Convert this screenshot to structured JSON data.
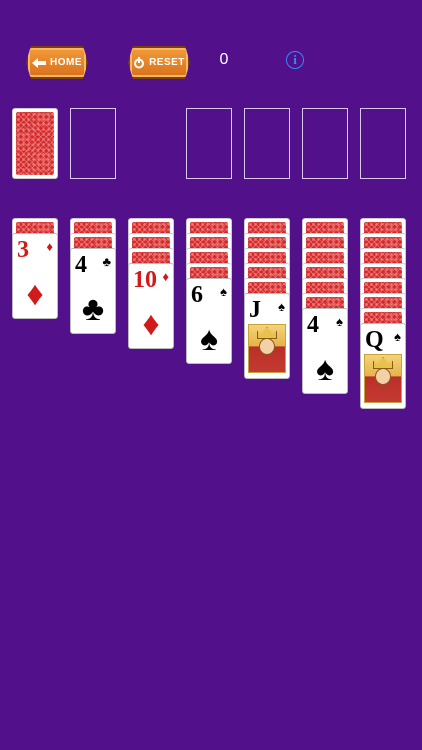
{
  "header": {
    "home_label": "HOME",
    "reset_label": "RESET",
    "score": "0",
    "info_symbol": "i"
  },
  "colors": {
    "background": "#52108a",
    "button": "#e9841f",
    "info": "#2a8cff",
    "red_suit": "#d11a1a"
  },
  "stock": {
    "face_down": true
  },
  "foundations": 4,
  "tableau": [
    {
      "hidden": 1,
      "top": {
        "rank": "3",
        "suit": "♦",
        "color": "red"
      }
    },
    {
      "hidden": 2,
      "top": {
        "rank": "4",
        "suit": "♣",
        "color": "black"
      }
    },
    {
      "hidden": 3,
      "top": {
        "rank": "10",
        "suit": "♦",
        "color": "red"
      }
    },
    {
      "hidden": 4,
      "top": {
        "rank": "6",
        "suit": "♠",
        "color": "black"
      }
    },
    {
      "hidden": 5,
      "top": {
        "rank": "J",
        "suit": "♠",
        "color": "black"
      }
    },
    {
      "hidden": 6,
      "top": {
        "rank": "4",
        "suit": "♠",
        "color": "black"
      }
    },
    {
      "hidden": 7,
      "top": {
        "rank": "Q",
        "suit": "♠",
        "color": "black"
      }
    }
  ]
}
